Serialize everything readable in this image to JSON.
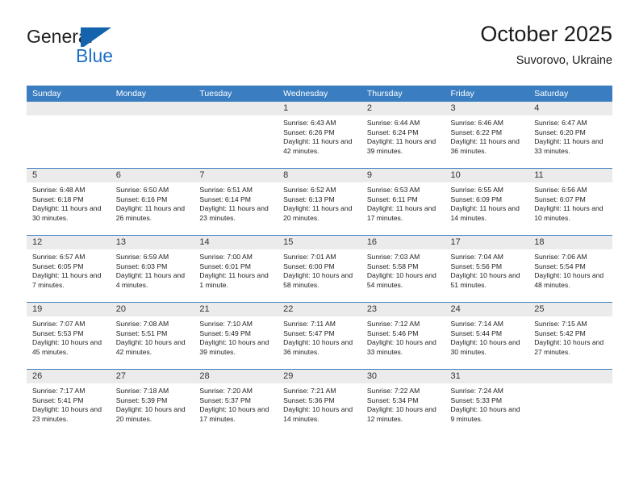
{
  "brand": {
    "name_top": "General",
    "name_bottom": "Blue",
    "mark": "blue-triangle-logo",
    "color_top": "#231f20",
    "color_bottom": "#1f6fc4"
  },
  "header": {
    "title": "October 2025",
    "subtitle": "Suvorovo, Ukraine"
  },
  "theme": {
    "header_bg": "#3a7ec1",
    "header_text": "#ffffff",
    "daynum_bg": "#ebebeb",
    "cell_bg": "#ffffff",
    "row_border": "#3a7ec1"
  },
  "calendar": {
    "weekday_headers": [
      "Sunday",
      "Monday",
      "Tuesday",
      "Wednesday",
      "Thursday",
      "Friday",
      "Saturday"
    ],
    "weeks": [
      [
        {
          "day": "",
          "sunrise": "",
          "sunset": "",
          "daylight": "",
          "empty": true
        },
        {
          "day": "",
          "sunrise": "",
          "sunset": "",
          "daylight": "",
          "empty": true
        },
        {
          "day": "",
          "sunrise": "",
          "sunset": "",
          "daylight": "",
          "empty": true
        },
        {
          "day": "1",
          "sunrise": "Sunrise: 6:43 AM",
          "sunset": "Sunset: 6:26 PM",
          "daylight": "Daylight: 11 hours and 42 minutes.",
          "empty": false
        },
        {
          "day": "2",
          "sunrise": "Sunrise: 6:44 AM",
          "sunset": "Sunset: 6:24 PM",
          "daylight": "Daylight: 11 hours and 39 minutes.",
          "empty": false
        },
        {
          "day": "3",
          "sunrise": "Sunrise: 6:46 AM",
          "sunset": "Sunset: 6:22 PM",
          "daylight": "Daylight: 11 hours and 36 minutes.",
          "empty": false
        },
        {
          "day": "4",
          "sunrise": "Sunrise: 6:47 AM",
          "sunset": "Sunset: 6:20 PM",
          "daylight": "Daylight: 11 hours and 33 minutes.",
          "empty": false
        }
      ],
      [
        {
          "day": "5",
          "sunrise": "Sunrise: 6:48 AM",
          "sunset": "Sunset: 6:18 PM",
          "daylight": "Daylight: 11 hours and 30 minutes.",
          "empty": false
        },
        {
          "day": "6",
          "sunrise": "Sunrise: 6:50 AM",
          "sunset": "Sunset: 6:16 PM",
          "daylight": "Daylight: 11 hours and 26 minutes.",
          "empty": false
        },
        {
          "day": "7",
          "sunrise": "Sunrise: 6:51 AM",
          "sunset": "Sunset: 6:14 PM",
          "daylight": "Daylight: 11 hours and 23 minutes.",
          "empty": false
        },
        {
          "day": "8",
          "sunrise": "Sunrise: 6:52 AM",
          "sunset": "Sunset: 6:13 PM",
          "daylight": "Daylight: 11 hours and 20 minutes.",
          "empty": false
        },
        {
          "day": "9",
          "sunrise": "Sunrise: 6:53 AM",
          "sunset": "Sunset: 6:11 PM",
          "daylight": "Daylight: 11 hours and 17 minutes.",
          "empty": false
        },
        {
          "day": "10",
          "sunrise": "Sunrise: 6:55 AM",
          "sunset": "Sunset: 6:09 PM",
          "daylight": "Daylight: 11 hours and 14 minutes.",
          "empty": false
        },
        {
          "day": "11",
          "sunrise": "Sunrise: 6:56 AM",
          "sunset": "Sunset: 6:07 PM",
          "daylight": "Daylight: 11 hours and 10 minutes.",
          "empty": false
        }
      ],
      [
        {
          "day": "12",
          "sunrise": "Sunrise: 6:57 AM",
          "sunset": "Sunset: 6:05 PM",
          "daylight": "Daylight: 11 hours and 7 minutes.",
          "empty": false
        },
        {
          "day": "13",
          "sunrise": "Sunrise: 6:59 AM",
          "sunset": "Sunset: 6:03 PM",
          "daylight": "Daylight: 11 hours and 4 minutes.",
          "empty": false
        },
        {
          "day": "14",
          "sunrise": "Sunrise: 7:00 AM",
          "sunset": "Sunset: 6:01 PM",
          "daylight": "Daylight: 11 hours and 1 minute.",
          "empty": false
        },
        {
          "day": "15",
          "sunrise": "Sunrise: 7:01 AM",
          "sunset": "Sunset: 6:00 PM",
          "daylight": "Daylight: 10 hours and 58 minutes.",
          "empty": false
        },
        {
          "day": "16",
          "sunrise": "Sunrise: 7:03 AM",
          "sunset": "Sunset: 5:58 PM",
          "daylight": "Daylight: 10 hours and 54 minutes.",
          "empty": false
        },
        {
          "day": "17",
          "sunrise": "Sunrise: 7:04 AM",
          "sunset": "Sunset: 5:56 PM",
          "daylight": "Daylight: 10 hours and 51 minutes.",
          "empty": false
        },
        {
          "day": "18",
          "sunrise": "Sunrise: 7:06 AM",
          "sunset": "Sunset: 5:54 PM",
          "daylight": "Daylight: 10 hours and 48 minutes.",
          "empty": false
        }
      ],
      [
        {
          "day": "19",
          "sunrise": "Sunrise: 7:07 AM",
          "sunset": "Sunset: 5:53 PM",
          "daylight": "Daylight: 10 hours and 45 minutes.",
          "empty": false
        },
        {
          "day": "20",
          "sunrise": "Sunrise: 7:08 AM",
          "sunset": "Sunset: 5:51 PM",
          "daylight": "Daylight: 10 hours and 42 minutes.",
          "empty": false
        },
        {
          "day": "21",
          "sunrise": "Sunrise: 7:10 AM",
          "sunset": "Sunset: 5:49 PM",
          "daylight": "Daylight: 10 hours and 39 minutes.",
          "empty": false
        },
        {
          "day": "22",
          "sunrise": "Sunrise: 7:11 AM",
          "sunset": "Sunset: 5:47 PM",
          "daylight": "Daylight: 10 hours and 36 minutes.",
          "empty": false
        },
        {
          "day": "23",
          "sunrise": "Sunrise: 7:12 AM",
          "sunset": "Sunset: 5:46 PM",
          "daylight": "Daylight: 10 hours and 33 minutes.",
          "empty": false
        },
        {
          "day": "24",
          "sunrise": "Sunrise: 7:14 AM",
          "sunset": "Sunset: 5:44 PM",
          "daylight": "Daylight: 10 hours and 30 minutes.",
          "empty": false
        },
        {
          "day": "25",
          "sunrise": "Sunrise: 7:15 AM",
          "sunset": "Sunset: 5:42 PM",
          "daylight": "Daylight: 10 hours and 27 minutes.",
          "empty": false
        }
      ],
      [
        {
          "day": "26",
          "sunrise": "Sunrise: 7:17 AM",
          "sunset": "Sunset: 5:41 PM",
          "daylight": "Daylight: 10 hours and 23 minutes.",
          "empty": false
        },
        {
          "day": "27",
          "sunrise": "Sunrise: 7:18 AM",
          "sunset": "Sunset: 5:39 PM",
          "daylight": "Daylight: 10 hours and 20 minutes.",
          "empty": false
        },
        {
          "day": "28",
          "sunrise": "Sunrise: 7:20 AM",
          "sunset": "Sunset: 5:37 PM",
          "daylight": "Daylight: 10 hours and 17 minutes.",
          "empty": false
        },
        {
          "day": "29",
          "sunrise": "Sunrise: 7:21 AM",
          "sunset": "Sunset: 5:36 PM",
          "daylight": "Daylight: 10 hours and 14 minutes.",
          "empty": false
        },
        {
          "day": "30",
          "sunrise": "Sunrise: 7:22 AM",
          "sunset": "Sunset: 5:34 PM",
          "daylight": "Daylight: 10 hours and 12 minutes.",
          "empty": false
        },
        {
          "day": "31",
          "sunrise": "Sunrise: 7:24 AM",
          "sunset": "Sunset: 5:33 PM",
          "daylight": "Daylight: 10 hours and 9 minutes.",
          "empty": false
        },
        {
          "day": "",
          "sunrise": "",
          "sunset": "",
          "daylight": "",
          "empty": true
        }
      ]
    ]
  }
}
